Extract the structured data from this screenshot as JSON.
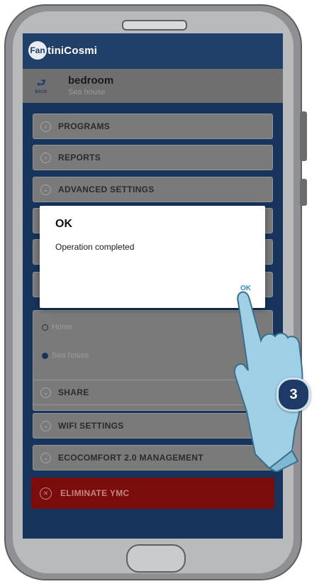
{
  "app": {
    "logo_mark": "Fan",
    "logo_text": "tiniCosmi"
  },
  "header": {
    "back_icon": "⮐",
    "back_label": "BACK",
    "title": "bedroom",
    "subtitle": "Sea house"
  },
  "menu": {
    "programs": "PROGRAMS",
    "reports": "REPORTS",
    "advanced_settings": "ADVANCED SETTINGS",
    "share": "SHARE",
    "wifi_settings": "WIFI SETTINGS",
    "ecocomfort": "ECOCOMFORT 2.0 MANAGEMENT",
    "eliminate": "ELIMINATE YMC"
  },
  "houses": {
    "options": [
      "Home",
      "Sea house"
    ],
    "selected": "Sea house"
  },
  "dialog": {
    "title": "OK",
    "message": "Operation completed",
    "ok_label": "OK"
  },
  "callout": {
    "step_number": "3"
  },
  "colors": {
    "brand": "#20406a",
    "danger": "#7a0c0c",
    "dialog_button": "#2d8fbd",
    "step_badge": "#1e3a66"
  },
  "icons": {
    "menu_chevron": "chevron-icon",
    "back": "back-icon",
    "eliminate": "close-circle-icon"
  }
}
